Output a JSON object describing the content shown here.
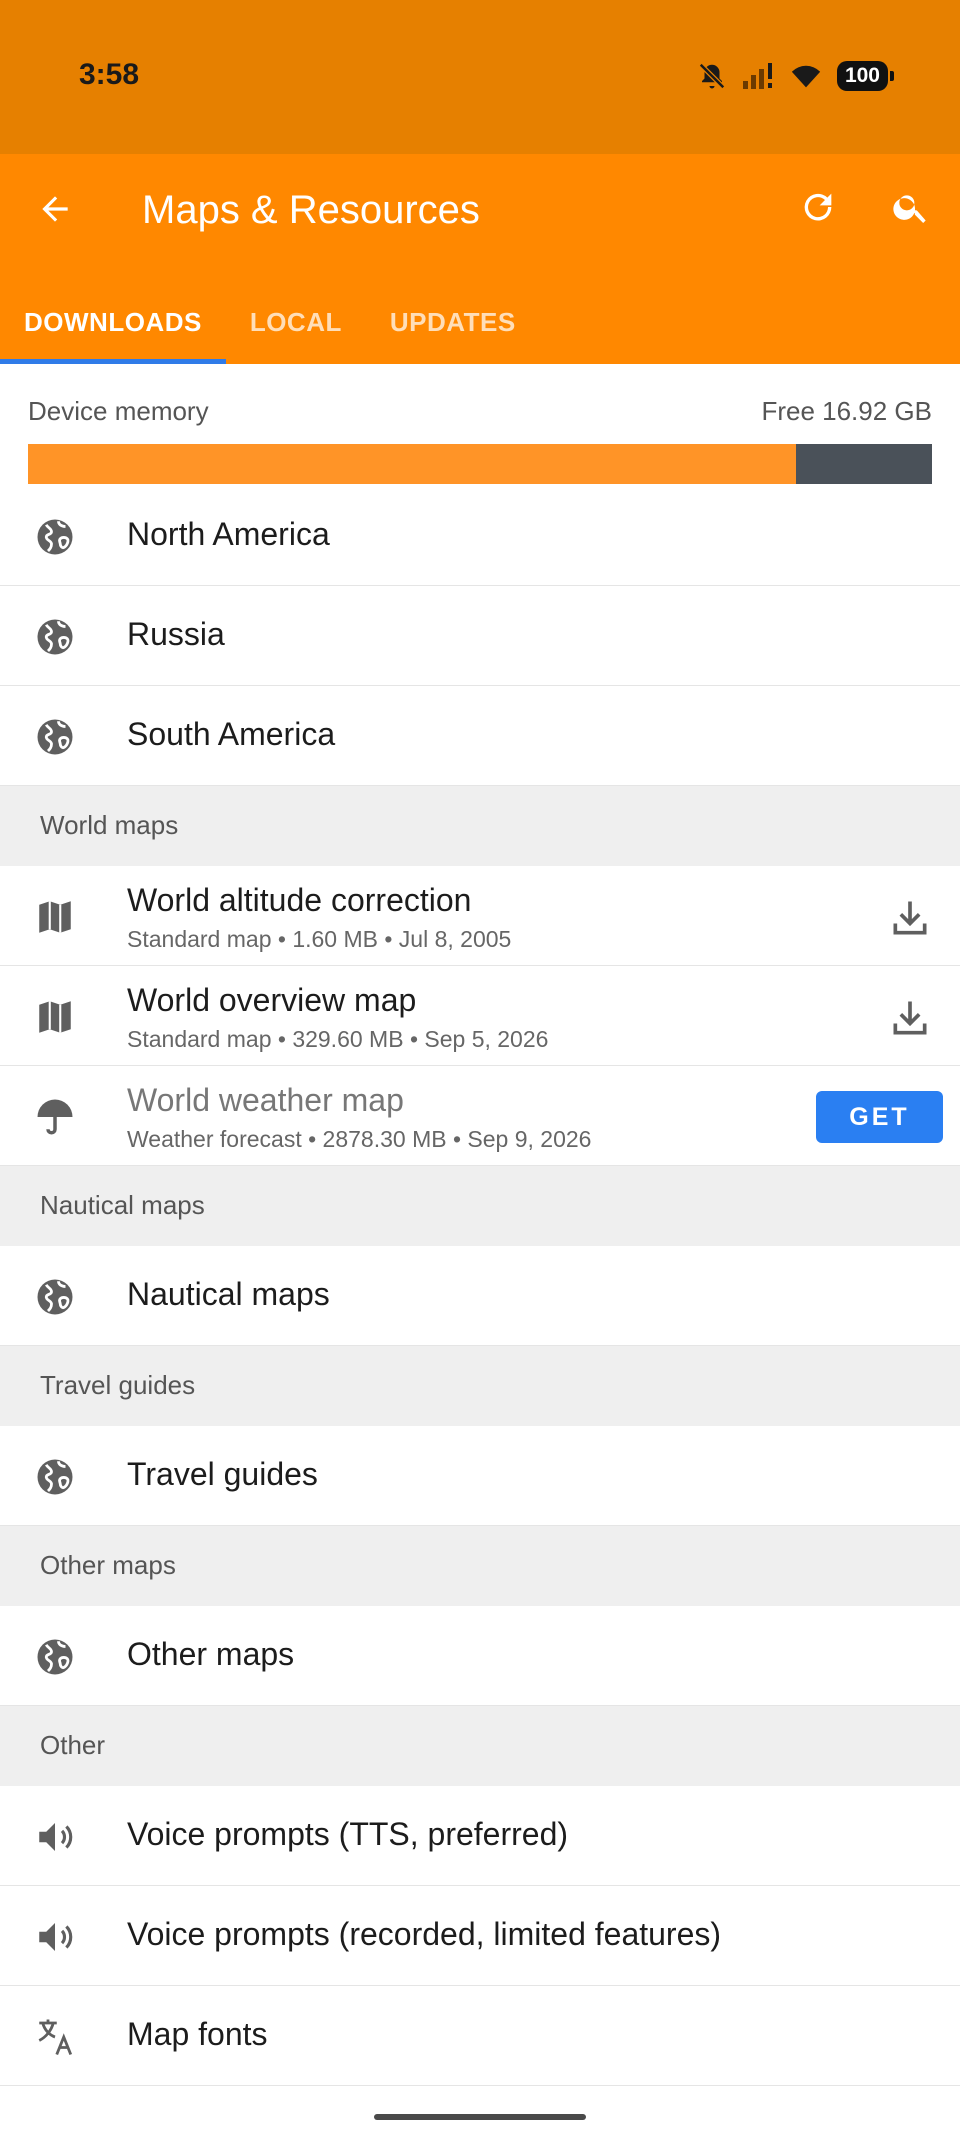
{
  "status_bar": {
    "time": "3:58",
    "battery": "100",
    "icons": [
      "mute-icon",
      "signal-icon",
      "wifi-icon",
      "battery-icon"
    ]
  },
  "app_bar": {
    "title": "Maps & Resources",
    "back_icon": "arrow-back-icon",
    "refresh_icon": "refresh-icon",
    "search_icon": "search-icon"
  },
  "tabs": [
    {
      "label": "DOWNLOADS",
      "active": true
    },
    {
      "label": "LOCAL",
      "active": false
    },
    {
      "label": "UPDATES",
      "active": false
    }
  ],
  "memory": {
    "label": "Device memory",
    "free": "Free 16.92 GB",
    "used_fraction": 0.85
  },
  "regions": [
    {
      "label": "North America",
      "icon": "globe-icon"
    },
    {
      "label": "Russia",
      "icon": "globe-icon"
    },
    {
      "label": "South America",
      "icon": "globe-icon"
    }
  ],
  "world_maps": {
    "header": "World maps",
    "items": [
      {
        "title": "World altitude correction",
        "subtitle": "Standard map • 1.60 MB • Jul 8, 2005",
        "icon": "map-icon",
        "action": "download"
      },
      {
        "title": "World overview map",
        "subtitle": "Standard map • 329.60 MB • Sep 5, 2026",
        "icon": "map-icon",
        "action": "download"
      },
      {
        "title": "World weather map",
        "subtitle": "Weather forecast • 2878.30 MB • Sep 9, 2026",
        "icon": "umbrella-icon",
        "action": "get",
        "action_label": "GET"
      }
    ]
  },
  "nautical": {
    "header": "Nautical maps",
    "item": "Nautical maps"
  },
  "travel": {
    "header": "Travel guides",
    "item": "Travel guides"
  },
  "other_maps": {
    "header": "Other maps",
    "item": "Other maps"
  },
  "other": {
    "header": "Other",
    "items": [
      {
        "label": "Voice prompts (TTS, preferred)",
        "icon": "speaker-icon"
      },
      {
        "label": "Voice prompts (recorded, limited features)",
        "icon": "speaker-icon"
      },
      {
        "label": "Map fonts",
        "icon": "translate-icon"
      }
    ]
  },
  "colors": {
    "status_bar": "#e68000",
    "app_bar": "#ff8800",
    "tab_indicator": "#2f7be8",
    "memory_used": "#ff9427",
    "memory_free": "#4a5159",
    "get_button": "#2a7ff2"
  }
}
